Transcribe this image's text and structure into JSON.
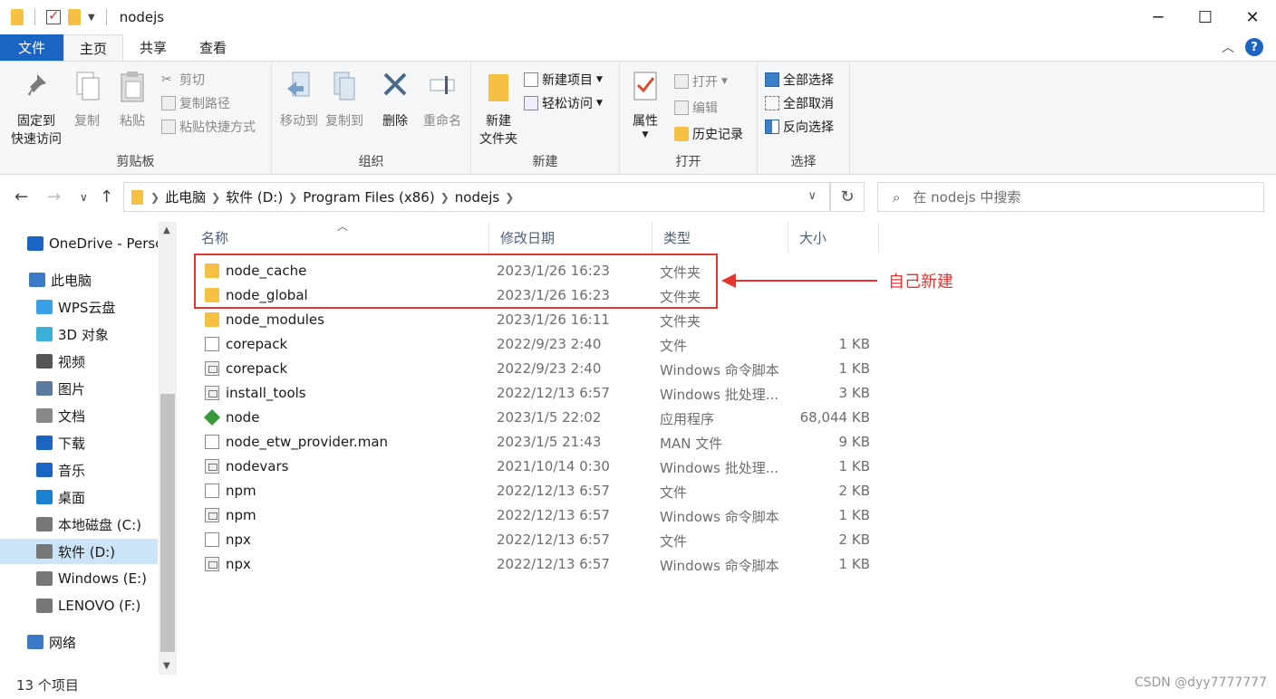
{
  "window": {
    "title": "nodejs",
    "controls": {
      "minimize": "─",
      "maximize": "☐",
      "close": "✕"
    }
  },
  "tabs": [
    "文件",
    "主页",
    "共享",
    "查看"
  ],
  "help_label": "?",
  "ribbon": {
    "clipboard": {
      "label": "剪贴板",
      "pin": "固定到\n快速访问",
      "pin_l1": "固定到",
      "pin_l2": "快速访问",
      "copy": "复制",
      "paste": "粘贴",
      "cut": "剪切",
      "copy_path": "复制路径",
      "paste_shortcut": "粘贴快捷方式"
    },
    "organize": {
      "label": "组织",
      "move_to": "移动到",
      "copy_to": "复制到",
      "delete": "删除",
      "rename": "重命名"
    },
    "new": {
      "label": "新建",
      "new_folder_l1": "新建",
      "new_folder_l2": "文件夹",
      "new_item": "新建项目",
      "easy_access": "轻松访问"
    },
    "open": {
      "label": "打开",
      "properties": "属性",
      "open": "打开",
      "edit": "编辑",
      "history": "历史记录"
    },
    "select": {
      "label": "选择",
      "select_all": "全部选择",
      "select_none": "全部取消",
      "invert": "反向选择"
    }
  },
  "address": {
    "crumbs": [
      "此电脑",
      "软件 (D:)",
      "Program Files (x86)",
      "nodejs"
    ],
    "search_placeholder": "在 nodejs 中搜索"
  },
  "sidebar": {
    "items": [
      {
        "label": "OneDrive - Personal",
        "icon": "onedrive-icon",
        "color": "#1a64c4"
      },
      {
        "label": "此电脑",
        "icon": "pc-icon",
        "color": "#3a7ac8"
      },
      {
        "label": "WPS云盘",
        "icon": "cloud-icon",
        "color": "#3aa0e8"
      },
      {
        "label": "3D 对象",
        "icon": "cube-icon",
        "color": "#3ab0d8"
      },
      {
        "label": "视频",
        "icon": "video-icon",
        "color": "#555"
      },
      {
        "label": "图片",
        "icon": "picture-icon",
        "color": "#5a7aa0"
      },
      {
        "label": "文档",
        "icon": "document-icon",
        "color": "#888"
      },
      {
        "label": "下载",
        "icon": "download-icon",
        "color": "#1a64c4"
      },
      {
        "label": "音乐",
        "icon": "music-icon",
        "color": "#1a64c4"
      },
      {
        "label": "桌面",
        "icon": "desktop-icon",
        "color": "#1a80d0"
      },
      {
        "label": "本地磁盘 (C:)",
        "icon": "disk-icon",
        "color": "#777"
      },
      {
        "label": "软件 (D:)",
        "icon": "disk-icon",
        "color": "#777"
      },
      {
        "label": "Windows (E:)",
        "icon": "disk-icon",
        "color": "#777"
      },
      {
        "label": "LENOVO (F:)",
        "icon": "disk-icon",
        "color": "#777"
      },
      {
        "label": "网络",
        "icon": "network-icon",
        "color": "#3a7ac8"
      }
    ]
  },
  "columns": {
    "name": "名称",
    "date": "修改日期",
    "type": "类型",
    "size": "大小"
  },
  "files": [
    {
      "name": "node_cache",
      "date": "2023/1/26 16:23",
      "type": "文件夹",
      "size": "",
      "icon": "folder-icon"
    },
    {
      "name": "node_global",
      "date": "2023/1/26 16:23",
      "type": "文件夹",
      "size": "",
      "icon": "folder-icon"
    },
    {
      "name": "node_modules",
      "date": "2023/1/26 16:11",
      "type": "文件夹",
      "size": "",
      "icon": "folder-icon"
    },
    {
      "name": "corepack",
      "date": "2022/9/23 2:40",
      "type": "文件",
      "size": "1 KB",
      "icon": "file-icon"
    },
    {
      "name": "corepack",
      "date": "2022/9/23 2:40",
      "type": "Windows 命令脚本",
      "size": "1 KB",
      "icon": "script-icon"
    },
    {
      "name": "install_tools",
      "date": "2022/12/13 6:57",
      "type": "Windows 批处理...",
      "size": "3 KB",
      "icon": "script-icon"
    },
    {
      "name": "node",
      "date": "2023/1/5 22:02",
      "type": "应用程序",
      "size": "68,044 KB",
      "icon": "node-app-icon"
    },
    {
      "name": "node_etw_provider.man",
      "date": "2023/1/5 21:43",
      "type": "MAN 文件",
      "size": "9 KB",
      "icon": "file-icon"
    },
    {
      "name": "nodevars",
      "date": "2021/10/14 0:30",
      "type": "Windows 批处理...",
      "size": "1 KB",
      "icon": "script-icon"
    },
    {
      "name": "npm",
      "date": "2022/12/13 6:57",
      "type": "文件",
      "size": "2 KB",
      "icon": "file-icon"
    },
    {
      "name": "npm",
      "date": "2022/12/13 6:57",
      "type": "Windows 命令脚本",
      "size": "1 KB",
      "icon": "script-icon"
    },
    {
      "name": "npx",
      "date": "2022/12/13 6:57",
      "type": "文件",
      "size": "2 KB",
      "icon": "file-icon"
    },
    {
      "name": "npx",
      "date": "2022/12/13 6:57",
      "type": "Windows 命令脚本",
      "size": "1 KB",
      "icon": "script-icon"
    }
  ],
  "annotation": {
    "text": "自己新建",
    "color": "#e8332e"
  },
  "status": "13 个项目",
  "watermark": "CSDN @dyy7777777"
}
